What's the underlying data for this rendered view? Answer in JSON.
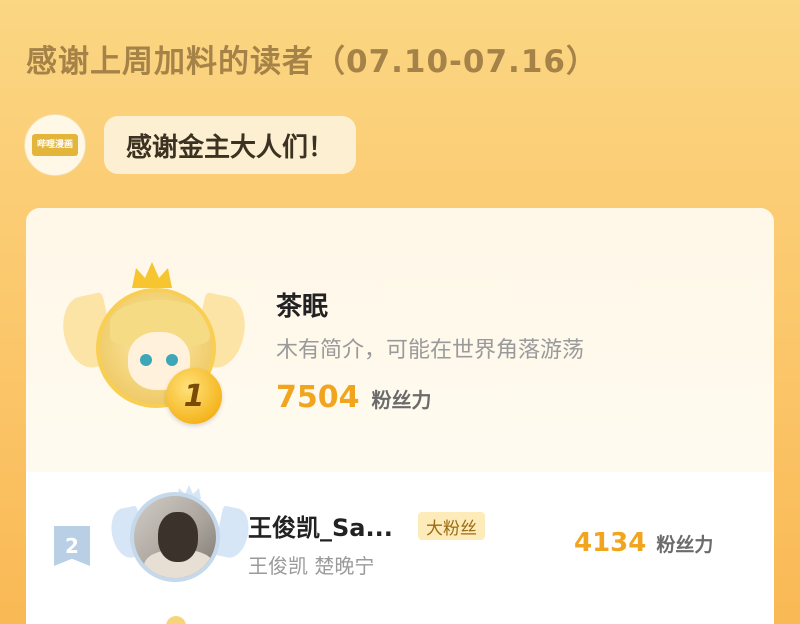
{
  "header": {
    "title": "感谢上周加料的读者（07.10-07.16）"
  },
  "logo": {
    "text": "哔哩漫画",
    "icon": "brand-logo"
  },
  "bubble": {
    "text": "感谢金主大人们！"
  },
  "ranking": [
    {
      "rank": "1",
      "name": "茶眠",
      "intro": "木有简介，可能在世界角落游荡",
      "score": "7504",
      "unit": "粉丝力"
    },
    {
      "rank": "2",
      "name": "王俊凯_Sa...",
      "badge": "大粉丝",
      "intro": "王俊凯 楚晚宁",
      "score": "4134",
      "unit": "粉丝力"
    }
  ],
  "colors": {
    "accent": "#f1a51f",
    "background": "#fbc568",
    "gold": "#f5b620",
    "silver": "#b8cfe6"
  }
}
